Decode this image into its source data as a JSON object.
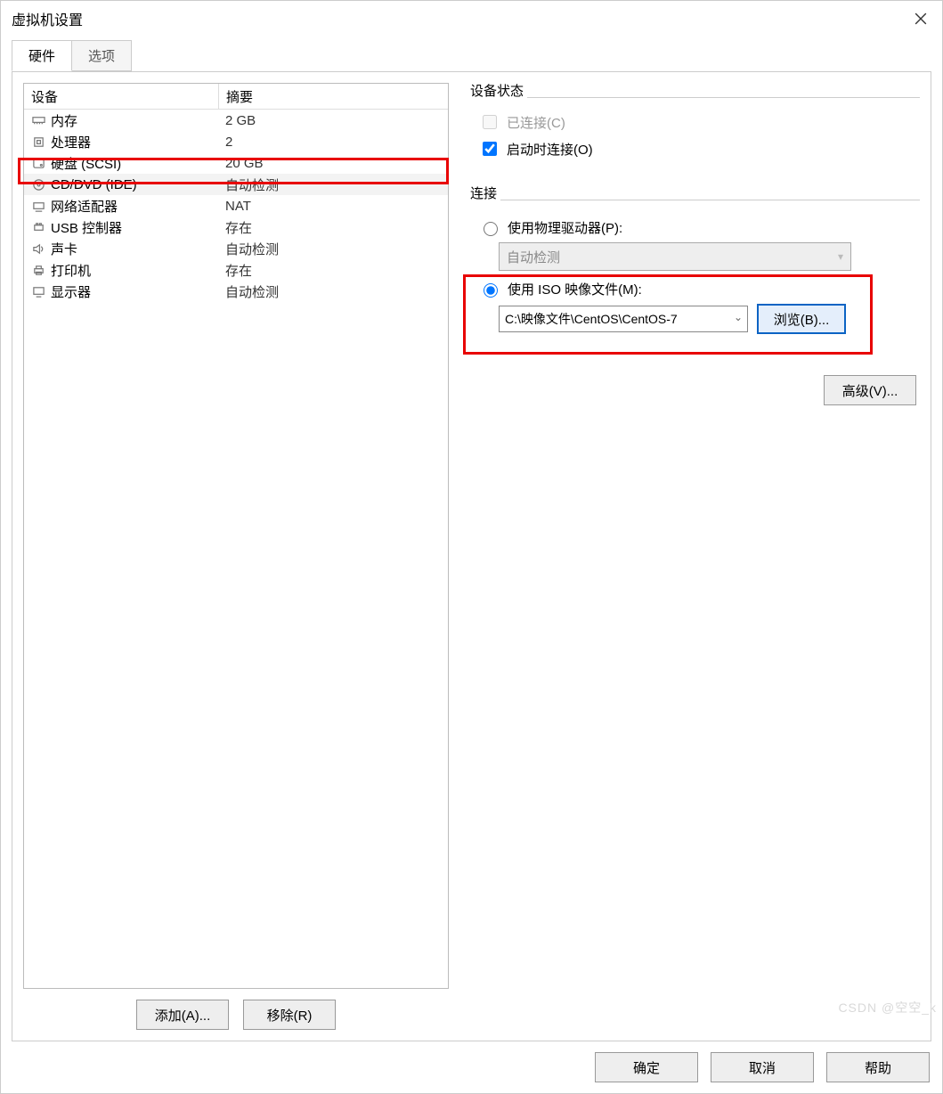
{
  "window": {
    "title": "虚拟机设置"
  },
  "tabs": {
    "hardware": "硬件",
    "options": "选项"
  },
  "device_table": {
    "header_device": "设备",
    "header_summary": "摘要",
    "rows": [
      {
        "icon": "memory",
        "name": "内存",
        "summary": "2 GB"
      },
      {
        "icon": "cpu",
        "name": "处理器",
        "summary": "2"
      },
      {
        "icon": "disk",
        "name": "硬盘 (SCSI)",
        "summary": "20 GB"
      },
      {
        "icon": "cd",
        "name": "CD/DVD (IDE)",
        "summary": "自动检测",
        "selected": true
      },
      {
        "icon": "net",
        "name": "网络适配器",
        "summary": "NAT"
      },
      {
        "icon": "usb",
        "name": "USB 控制器",
        "summary": "存在"
      },
      {
        "icon": "sound",
        "name": "声卡",
        "summary": "自动检测"
      },
      {
        "icon": "printer",
        "name": "打印机",
        "summary": "存在"
      },
      {
        "icon": "display",
        "name": "显示器",
        "summary": "自动检测"
      }
    ]
  },
  "buttons": {
    "add": "添加(A)...",
    "remove": "移除(R)",
    "browse": "浏览(B)...",
    "advanced": "高级(V)...",
    "ok": "确定",
    "cancel": "取消",
    "help": "帮助"
  },
  "device_status": {
    "group": "设备状态",
    "connected": "已连接(C)",
    "connect_at_poweron": "启动时连接(O)"
  },
  "connection": {
    "group": "连接",
    "use_physical": "使用物理驱动器(P):",
    "physical_value": "自动检测",
    "use_iso": "使用 ISO 映像文件(M):",
    "iso_path": "C:\\映像文件\\CentOS\\CentOS-7"
  },
  "watermark": "CSDN @空空_k"
}
